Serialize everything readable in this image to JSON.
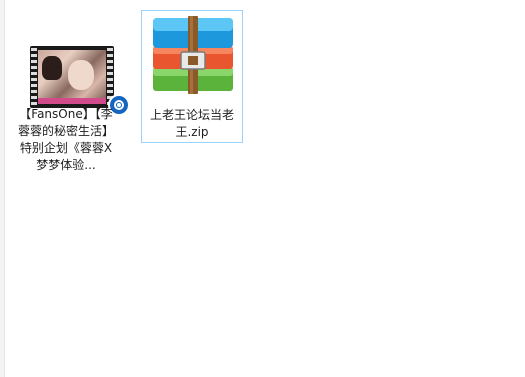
{
  "desktop": {
    "files": [
      {
        "name": "【FansOne】【李蓉蓉的秘密生活】特别企划《蓉蓉X梦梦体验...",
        "icon": "video-file-icon",
        "selected": false
      },
      {
        "name": "上老王论坛当老王.zip",
        "icon": "winrar-archive-icon",
        "selected": true
      }
    ]
  },
  "colors": {
    "selection_border": "#99d1ff",
    "archive_blue": "#29a9e8",
    "archive_red": "#f0613f",
    "archive_green": "#6cc24a",
    "strap_brown": "#8b5a2b",
    "media_badge": "#1565c0"
  }
}
